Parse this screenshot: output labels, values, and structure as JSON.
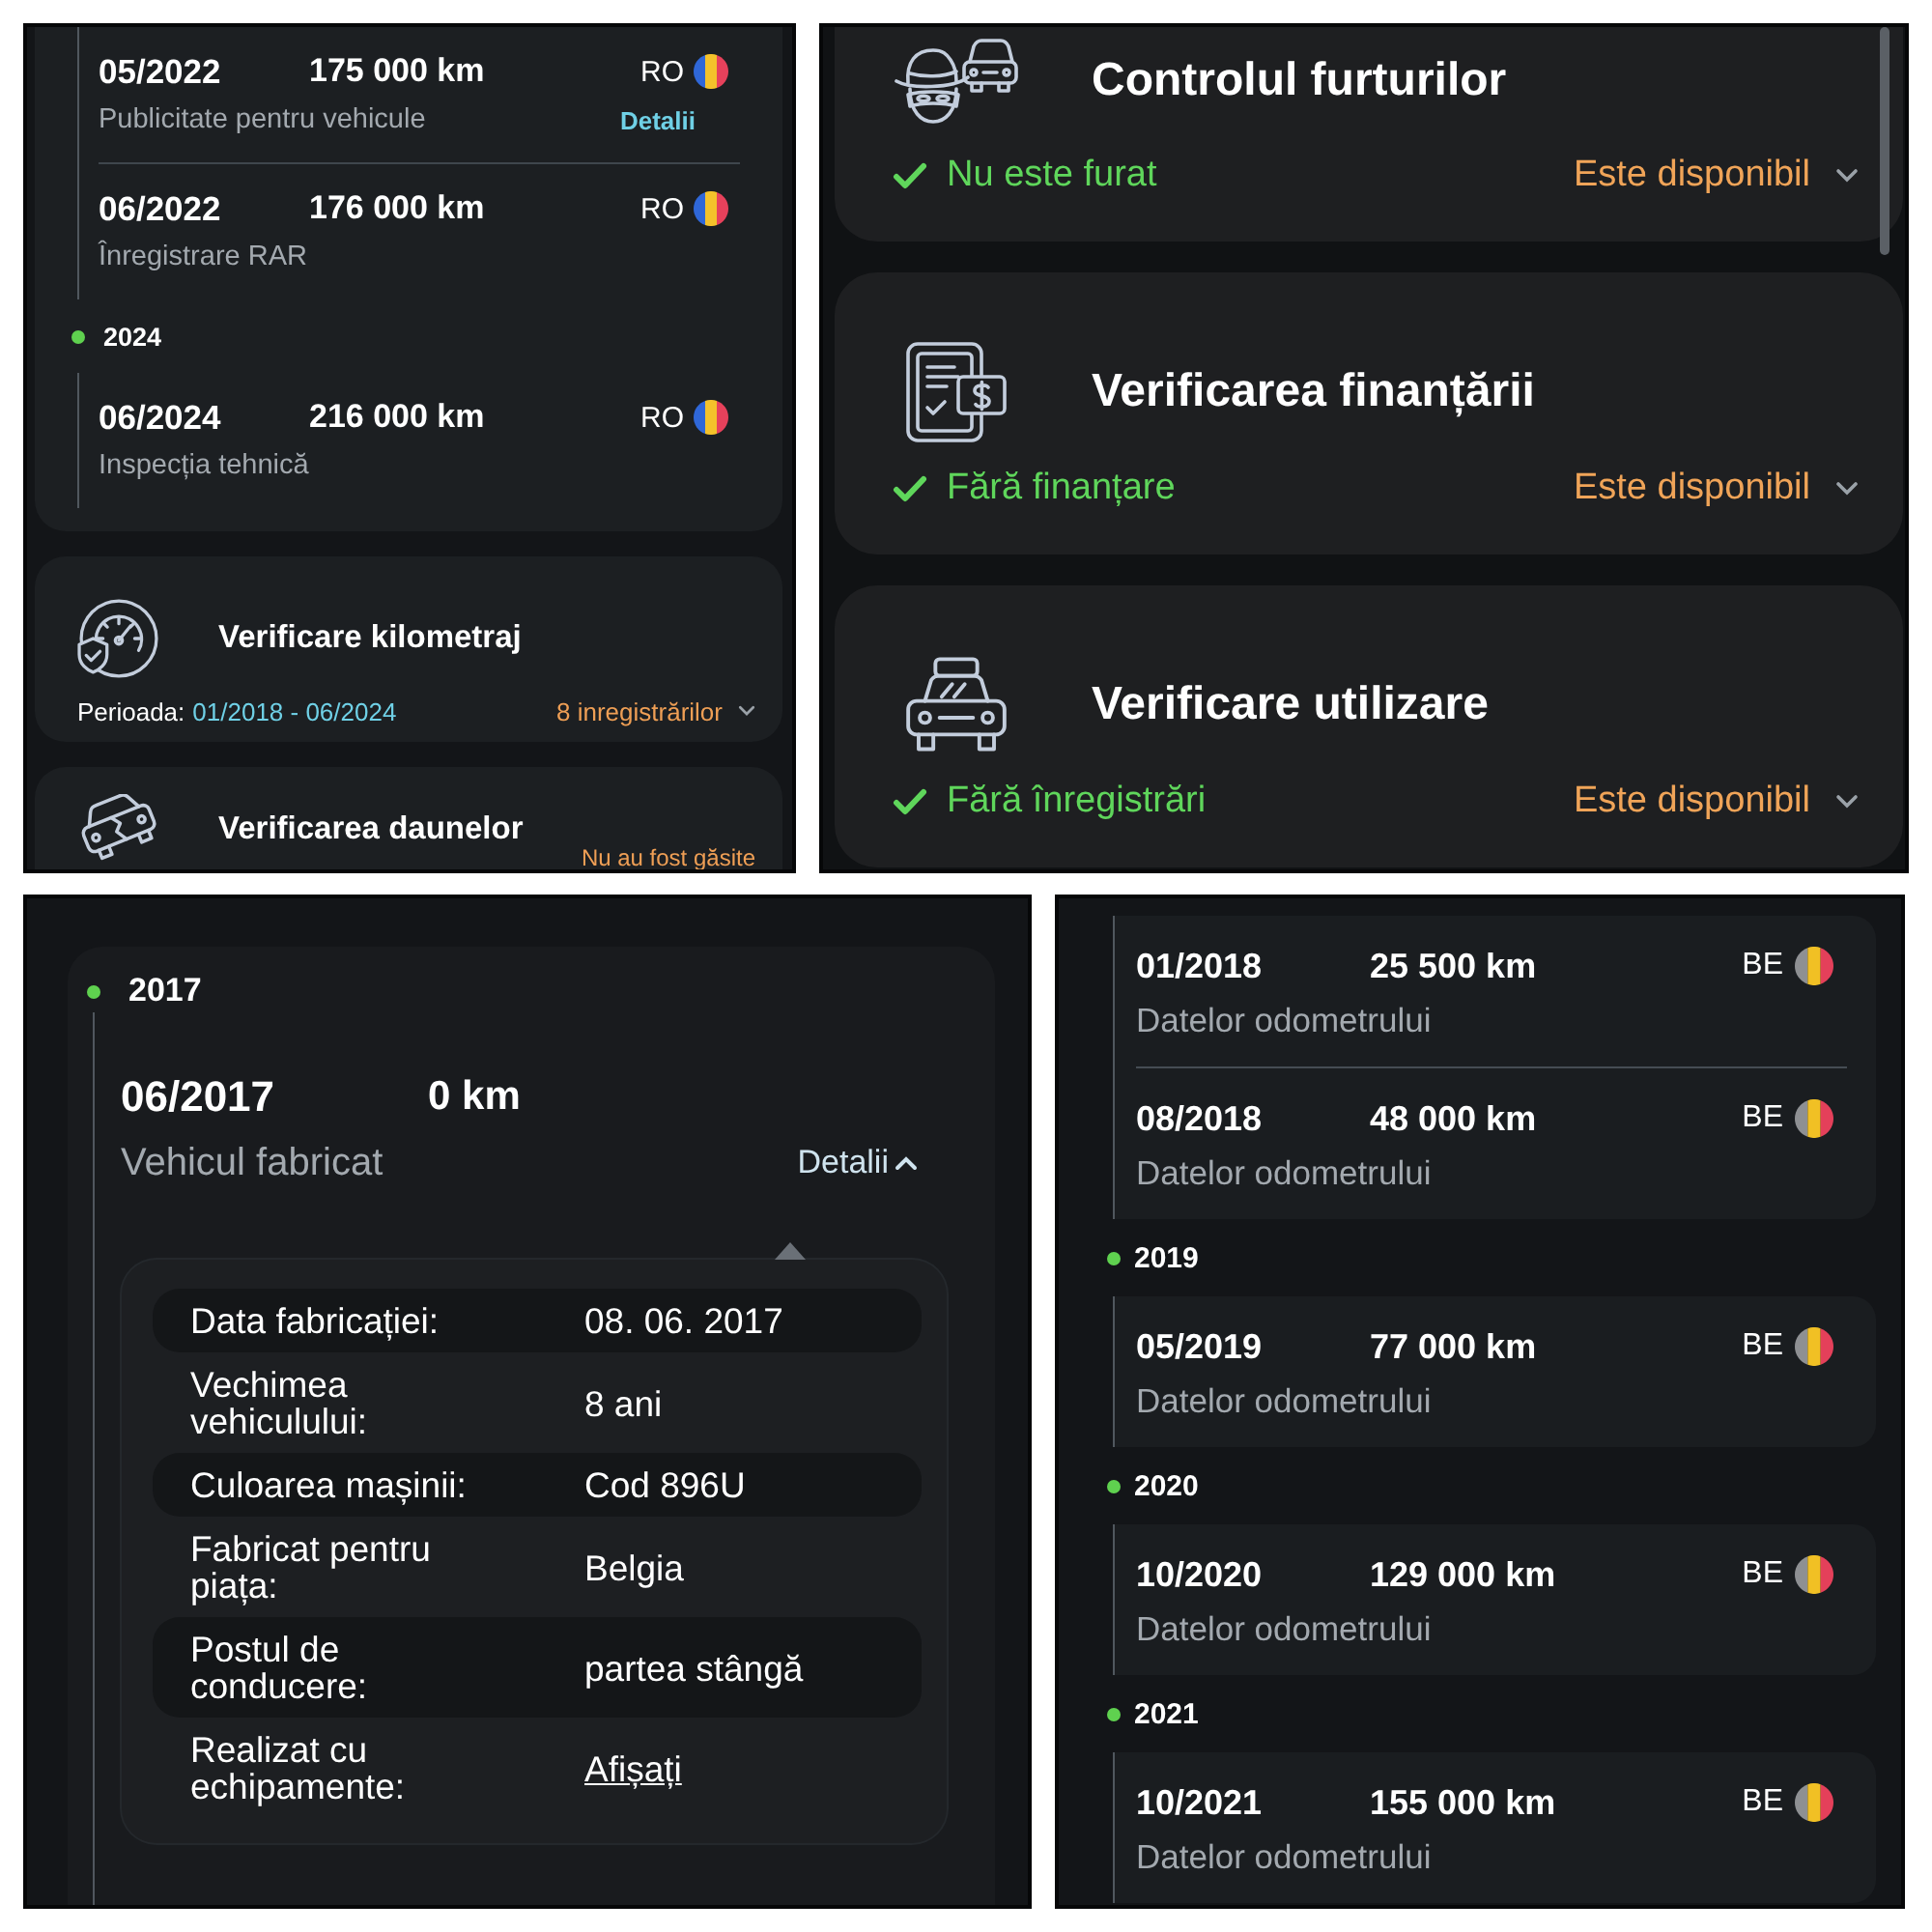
{
  "history_top": {
    "groups": [
      {
        "entries": [
          {
            "date": "05/2022",
            "mileage": "175 000 km",
            "country": "RO",
            "source": "Publicitate pentru vehicule",
            "details_link": "Detalii"
          },
          {
            "date": "06/2022",
            "mileage": "176 000 km",
            "country": "RO",
            "source": "Înregistrare RAR"
          }
        ]
      },
      {
        "year": "2024",
        "entries": [
          {
            "date": "06/2024",
            "mileage": "216 000 km",
            "country": "RO",
            "source": "Inspecția tehnică"
          }
        ]
      }
    ]
  },
  "checks_left": [
    {
      "kind": "mileage",
      "title": "Verificare kilometraj",
      "period_label": "Perioada:",
      "period": "01/2018 - 06/2024",
      "records": "8 inregistrărilor"
    },
    {
      "kind": "damage",
      "title": "Verificarea daunelor",
      "result": "Nu au fost găsite"
    }
  ],
  "checks_right": [
    {
      "kind": "theft",
      "title": "Controlul furturilor",
      "result": "Nu este furat",
      "availability": "Este disponibil"
    },
    {
      "kind": "financing",
      "title": "Verificarea finanțării",
      "result": "Fără finanțare",
      "availability": "Este disponibil"
    },
    {
      "kind": "usage",
      "title": "Verificare utilizare",
      "result": "Fără înregistrări",
      "availability": "Este disponibil"
    }
  ],
  "manufacture": {
    "year": "2017",
    "date": "06/2017",
    "mileage": "0 km",
    "source": "Vehicul fabricat",
    "details_link": "Detalii",
    "expanded": true,
    "details": [
      {
        "kind": "text",
        "label": "Data fabricației:",
        "value": "08. 06. 2017"
      },
      {
        "kind": "text",
        "label": "Vechimea vehiculului:",
        "value": "8 ani"
      },
      {
        "kind": "text",
        "label": "Culoarea mașinii:",
        "value": "Cod 896U"
      },
      {
        "kind": "text",
        "label": "Fabricat pentru piața:",
        "value": "Belgia"
      },
      {
        "kind": "text",
        "label": "Postul de conducere:",
        "value": "partea stângă"
      },
      {
        "kind": "link",
        "label": "Realizat cu echipamente:",
        "value": "Afișați"
      }
    ]
  },
  "history_bottom": {
    "groups": [
      {
        "entries": [
          {
            "date": "01/2018",
            "mileage": "25 500 km",
            "country": "BE",
            "source": "Datelor odometrului"
          },
          {
            "date": "08/2018",
            "mileage": "48 000 km",
            "country": "BE",
            "source": "Datelor odometrului"
          }
        ]
      },
      {
        "year": "2019",
        "entries": [
          {
            "date": "05/2019",
            "mileage": "77 000 km",
            "country": "BE",
            "source": "Datelor odometrului"
          }
        ]
      },
      {
        "year": "2020",
        "entries": [
          {
            "date": "10/2020",
            "mileage": "129 000 km",
            "country": "BE",
            "source": "Datelor odometrului"
          }
        ]
      },
      {
        "year": "2021",
        "entries": [
          {
            "date": "10/2021",
            "mileage": "155 000 km",
            "country": "BE",
            "source": "Datelor odometrului"
          }
        ]
      }
    ]
  }
}
